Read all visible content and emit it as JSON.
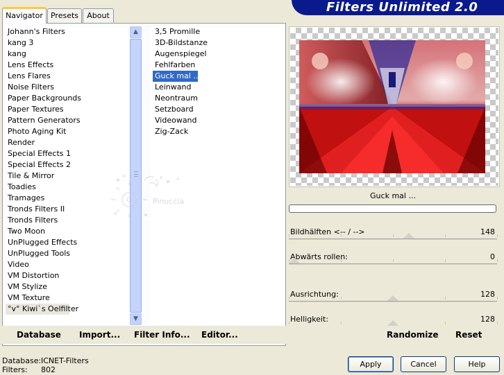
{
  "tabs": [
    {
      "label": "Navigator",
      "active": true
    },
    {
      "label": "Presets",
      "active": false
    },
    {
      "label": "About",
      "active": false
    }
  ],
  "banner_title": "Filters Unlimited 2.0",
  "categories": [
    {
      "label": "Johann's Filters"
    },
    {
      "label": "kang 3"
    },
    {
      "label": "kang"
    },
    {
      "label": "Lens Effects"
    },
    {
      "label": "Lens Flares"
    },
    {
      "label": "Noise Filters"
    },
    {
      "label": "Paper Backgrounds"
    },
    {
      "label": "Paper Textures"
    },
    {
      "label": "Pattern Generators"
    },
    {
      "label": "Photo Aging Kit"
    },
    {
      "label": "Render"
    },
    {
      "label": "Special Effects 1"
    },
    {
      "label": "Special Effects 2"
    },
    {
      "label": "Tile & Mirror"
    },
    {
      "label": "Toadies"
    },
    {
      "label": "Tramages"
    },
    {
      "label": "Tronds Filters II"
    },
    {
      "label": "Tronds Filters"
    },
    {
      "label": "Two Moon"
    },
    {
      "label": "UnPlugged Effects"
    },
    {
      "label": "UnPlugged Tools"
    },
    {
      "label": "Video"
    },
    {
      "label": "VM Distortion"
    },
    {
      "label": "VM Stylize"
    },
    {
      "label": "VM Texture"
    },
    {
      "label": "°v° Kiwi`s Oelfilter"
    }
  ],
  "selected_category_index": 25,
  "filters": [
    {
      "label": "3,5 Promille"
    },
    {
      "label": "3D-Bildstanze"
    },
    {
      "label": "Augenspiegel"
    },
    {
      "label": "Fehlfarben"
    },
    {
      "label": "Guck mal ..."
    },
    {
      "label": "Leinwand"
    },
    {
      "label": "Neontraum"
    },
    {
      "label": "Setzboard"
    },
    {
      "label": "Videowand"
    },
    {
      "label": "Zig-Zack"
    }
  ],
  "selected_filter_index": 4,
  "watermark_text": "Pinuccia",
  "preview_filter_name": "Guck mal ...",
  "parameters": [
    {
      "label": "Bildhälften <-- / -->",
      "value": "148",
      "fraction": 0.58
    },
    {
      "label": "Abwärts rollen:",
      "value": "0",
      "fraction": 0.0
    },
    {
      "label": "Ausrichtung:",
      "value": "128",
      "fraction": 0.5
    },
    {
      "label": "Helligkeit:",
      "value": "128",
      "fraction": 0.5
    }
  ],
  "nav_buttons": {
    "database": "Database",
    "import": "Import...",
    "filter_info": "Filter Info...",
    "editor": "Editor...",
    "randomize": "Randomize",
    "reset": "Reset"
  },
  "status": {
    "database_label": "Database:",
    "database_value": "ICNET-Filters",
    "filters_label": "Filters:",
    "filters_value": "802"
  },
  "buttons": {
    "apply": "Apply",
    "cancel": "Cancel",
    "help": "Help"
  },
  "colors": {
    "banner": "#0a1a8c",
    "selection": "#316ac5",
    "window_bg": "#ece9d8"
  }
}
